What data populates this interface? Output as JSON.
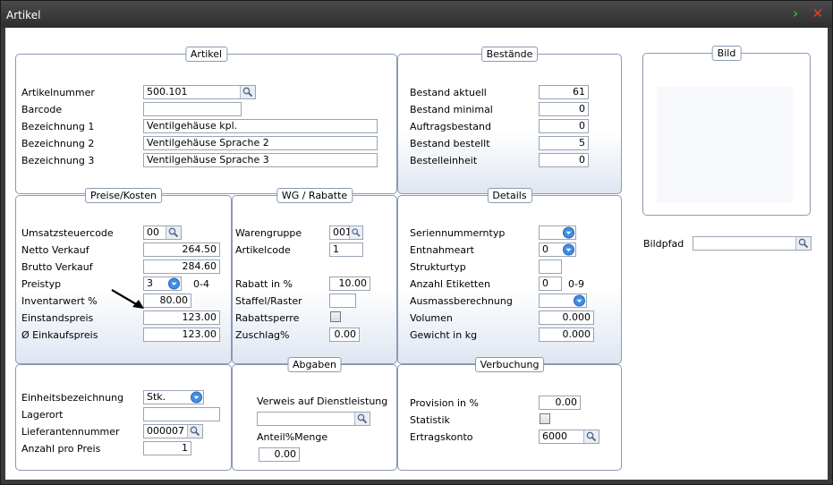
{
  "window": {
    "title": "Artikel"
  },
  "artikel": {
    "legend": "Artikel",
    "artikelnummer_label": "Artikelnummer",
    "artikelnummer": "500.101",
    "barcode_label": "Barcode",
    "barcode": "",
    "bez1_label": "Bezeichnung 1",
    "bez1": "Ventilgehäuse kpl.",
    "bez2_label": "Bezeichnung 2",
    "bez2": "Ventilgehäuse Sprache 2",
    "bez3_label": "Bezeichnung 3",
    "bez3": "Ventilgehäuse Sprache 3"
  },
  "bestaende": {
    "legend": "Bestände",
    "aktuell_label": "Bestand aktuell",
    "aktuell": "61",
    "minimal_label": "Bestand minimal",
    "minimal": "0",
    "auftrag_label": "Auftragsbestand",
    "auftrag": "0",
    "bestellt_label": "Bestand bestellt",
    "bestellt": "5",
    "einheit_label": "Bestelleinheit",
    "einheit": "0"
  },
  "bild": {
    "legend": "Bild",
    "bildpfad_label": "Bildpfad",
    "bildpfad": ""
  },
  "preise": {
    "legend": "Preise/Kosten",
    "ust_label": "Umsatzsteuercode",
    "ust": "00",
    "netto_label": "Netto Verkauf",
    "netto": "264.50",
    "brutto_label": "Brutto Verkauf",
    "brutto": "284.60",
    "preistyp_label": "Preistyp",
    "preistyp": "3",
    "preistyp_range": "0-4",
    "inventar_label": "Inventarwert %",
    "inventar": "80.00",
    "einstand_label": "Einstandspreis",
    "einstand": "123.00",
    "einkauf_label": "Ø Einkaufspreis",
    "einkauf": "123.00"
  },
  "wg": {
    "legend": "WG / Rabatte",
    "warengruppe_label": "Warengruppe",
    "warengruppe": "001",
    "artikelcode_label": "Artikelcode",
    "artikelcode": "1",
    "rabatt_label": "Rabatt in %",
    "rabatt": "10.00",
    "staffel_label": "Staffel/Raster",
    "staffel": "",
    "sperre_label": "Rabattsperre",
    "zuschlag_label": "Zuschlag%",
    "zuschlag": "0.00"
  },
  "details": {
    "legend": "Details",
    "seriennr_label": "Seriennummerntyp",
    "seriennr": "",
    "entnahme_label": "Entnahmeart",
    "entnahme": "0",
    "struktur_label": "Strukturtyp",
    "struktur": "",
    "etiketten_label": "Anzahl Etiketten",
    "etiketten": "0",
    "etiketten_range": "0-9",
    "ausmass_label": "Ausmassberechnung",
    "ausmass": "",
    "volumen_label": "Volumen",
    "volumen": "0.000",
    "gewicht_label": "Gewicht in kg",
    "gewicht": "0.000"
  },
  "einheit": {
    "einheitsbez_label": "Einheitsbezeichnung",
    "einheitsbez": "Stk.",
    "lagerort_label": "Lagerort",
    "lagerort": "",
    "lieferant_label": "Lieferantennummer",
    "lieferant": "000007",
    "anzahl_label": "Anzahl pro Preis",
    "anzahl": "1"
  },
  "abgaben": {
    "legend": "Abgaben",
    "verweis_label": "Verweis auf Dienstleistung",
    "verweis": "",
    "anteil_label": "Anteil%Menge",
    "anteil": "0.00"
  },
  "verbuchung": {
    "legend": "Verbuchung",
    "provision_label": "Provision in %",
    "provision": "0.00",
    "statistik_label": "Statistik",
    "ertrag_label": "Ertragskonto",
    "ertrag": "6000"
  },
  "icons": {
    "lookup": "magnifier-icon",
    "combo": "dropdown-circle-icon",
    "ok": "chevron-right-icon",
    "close": "close-x-icon"
  },
  "colors": {
    "titlebar": "#3a3a3a",
    "border": "#8b9ab2",
    "ok": "#36b23a",
    "close": "#e83a2a"
  }
}
